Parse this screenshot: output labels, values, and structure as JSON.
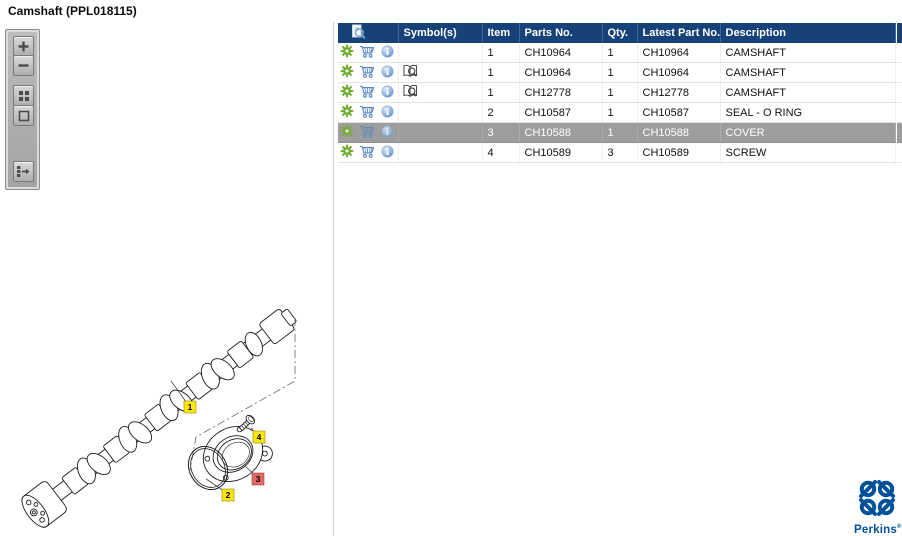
{
  "title": "Camshaft (PPL018115)",
  "toolbar": {
    "buttons": [
      {
        "name": "zoom-in"
      },
      {
        "name": "zoom-out"
      },
      {
        "name": "tile-view"
      },
      {
        "name": "fit-view"
      },
      {
        "name": "toggle-parts-list"
      }
    ]
  },
  "parts_table": {
    "header": {
      "preview": "",
      "symbols": "Symbol(s)",
      "item": "Item",
      "parts_no": "Parts No.",
      "qty": "Qty.",
      "latest_part_no": "Latest Part No.",
      "description": "Description"
    },
    "rows": [
      {
        "item": "1",
        "parts_no": "CH10964",
        "qty": "1",
        "latest_part_no": "CH10964",
        "description": "CAMSHAFT",
        "has_symbol": false,
        "selected": false
      },
      {
        "item": "1",
        "parts_no": "CH10964",
        "qty": "1",
        "latest_part_no": "CH10964",
        "description": "CAMSHAFT",
        "has_symbol": true,
        "selected": false
      },
      {
        "item": "1",
        "parts_no": "CH12778",
        "qty": "1",
        "latest_part_no": "CH12778",
        "description": "CAMSHAFT",
        "has_symbol": true,
        "selected": false
      },
      {
        "item": "2",
        "parts_no": "CH10587",
        "qty": "1",
        "latest_part_no": "CH10587",
        "description": "SEAL - O RING",
        "has_symbol": false,
        "selected": false
      },
      {
        "item": "3",
        "parts_no": "CH10588",
        "qty": "1",
        "latest_part_no": "CH10588",
        "description": "COVER",
        "has_symbol": false,
        "selected": true
      },
      {
        "item": "4",
        "parts_no": "CH10589",
        "qty": "3",
        "latest_part_no": "CH10589",
        "description": "SCREW",
        "has_symbol": false,
        "selected": false
      }
    ]
  },
  "diagram": {
    "callouts": [
      {
        "label": "1",
        "highlighted": false
      },
      {
        "label": "2",
        "highlighted": false
      },
      {
        "label": "3",
        "highlighted": true
      },
      {
        "label": "4",
        "highlighted": false
      }
    ]
  },
  "branding": {
    "name": "Perkins",
    "mark": "®"
  },
  "colors": {
    "header_bg": "#164279",
    "selected_row_bg": "#9d9d9d",
    "callout_yellow": "#ffe600",
    "callout_highlight": "#e06a63",
    "perkins_blue": "#00529B",
    "gear_green": "#72AE2E",
    "cart_blue": "#5A86C2"
  }
}
